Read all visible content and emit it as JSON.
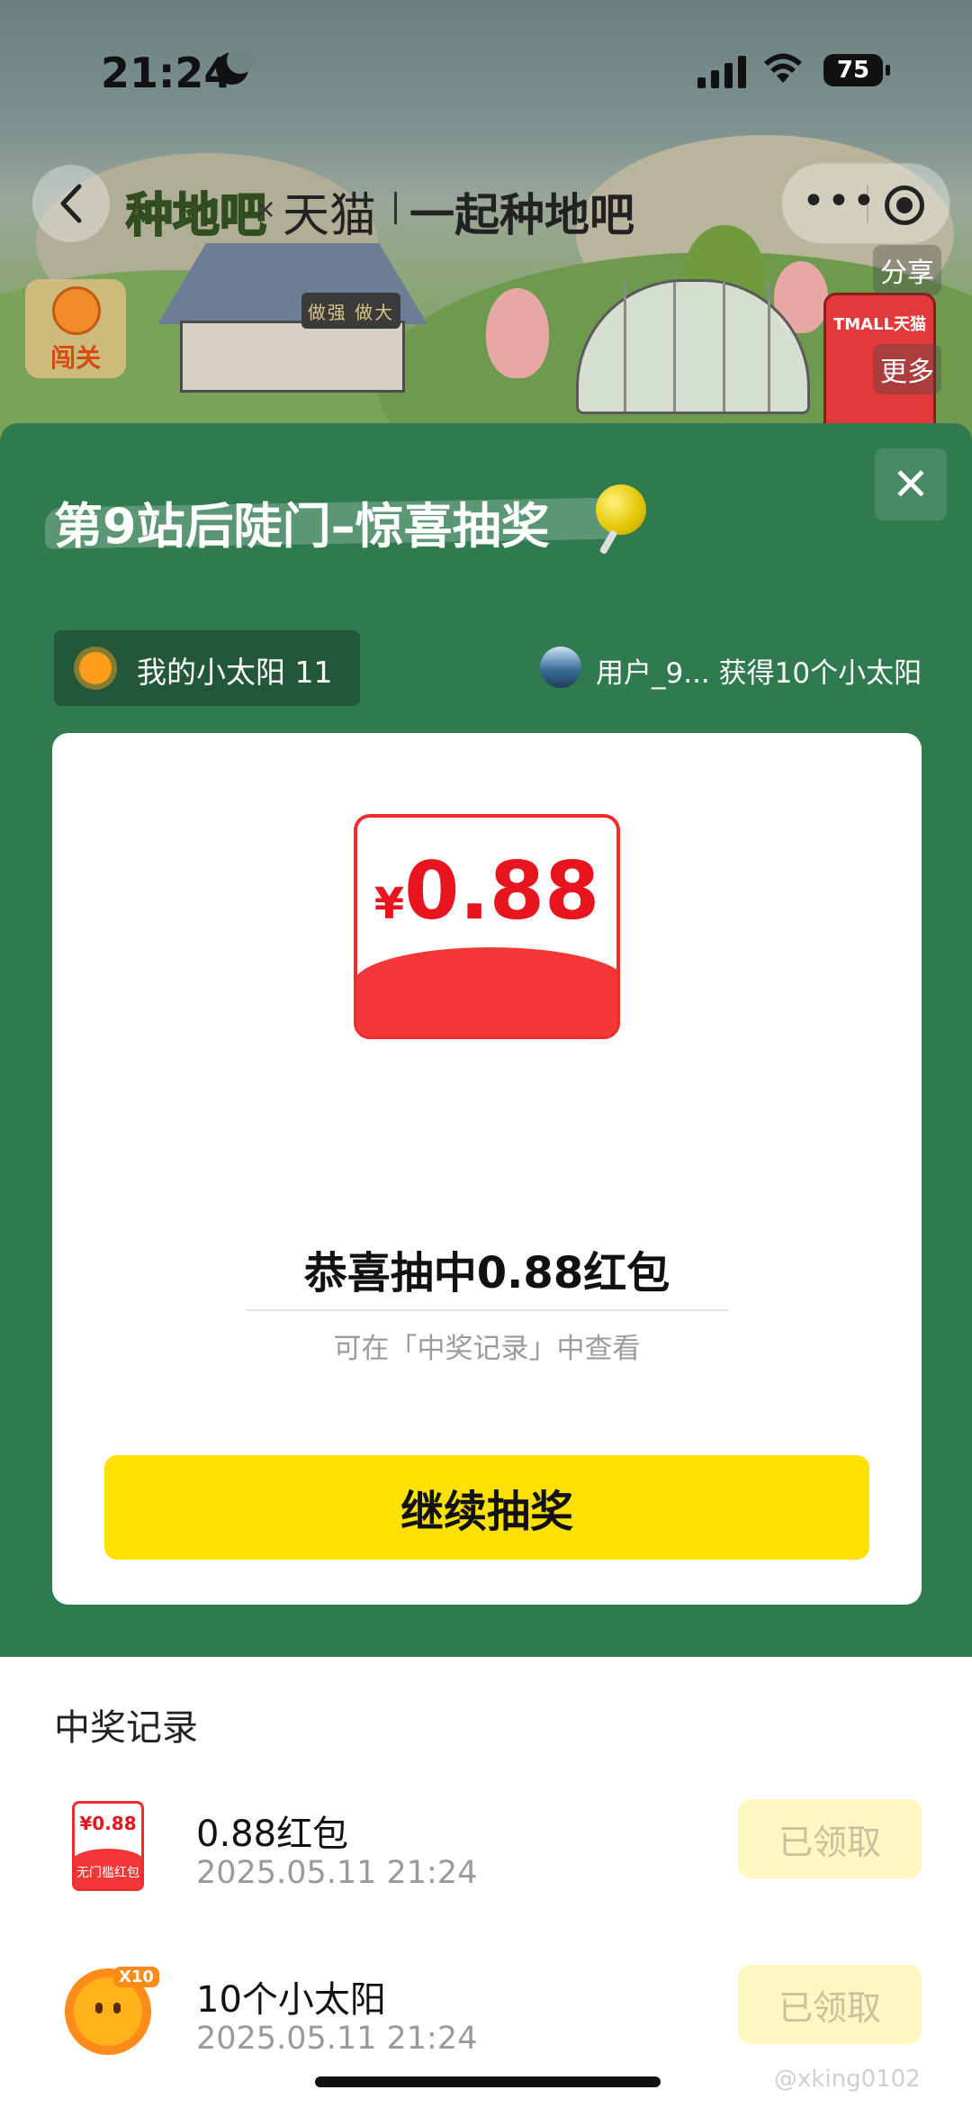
{
  "status_bar": {
    "time": "21:24",
    "battery": "75"
  },
  "nav": {
    "logo_game": "种地吧",
    "logo_x": "×",
    "logo_tmall": "天猫",
    "title": "一起种地吧",
    "more_dots": "•••"
  },
  "scene": {
    "levels_label": "闯关",
    "share_label": "分享",
    "more_label": "更多",
    "sign_text": "做强 做大",
    "tmall_box_text": "TMALL天猫"
  },
  "sheet": {
    "title": "第9站后陡门–惊喜抽奖",
    "close_glyph": "✕",
    "my_sun": "我的小太阳 11",
    "notice": "用户_9... 获得10个小太阳"
  },
  "prize_card": {
    "currency": "¥",
    "amount": "0.88",
    "prize_type": "无门槛红包",
    "congrats": "恭喜抽中0.88红包",
    "hint": "可在「中奖记录」中查看",
    "continue_button": "继续抽奖"
  },
  "records": {
    "title": "中奖记录",
    "items": [
      {
        "icon": "red-envelope-icon",
        "icon_amount": "¥0.88",
        "icon_label": "无门槛红包",
        "name": "0.88红包",
        "date": "2025.05.11 21:24",
        "status": "已领取"
      },
      {
        "icon": "sun-icon",
        "icon_badge": "X10",
        "name": "10个小太阳",
        "date": "2025.05.11 21:24",
        "status": "已领取"
      }
    ]
  },
  "watermark": "@xking0102",
  "colors": {
    "sheet_green": "#2f7a4f",
    "accent_yellow": "#ffe100",
    "envelope_red": "#f53636",
    "amount_red": "#e8141e"
  }
}
